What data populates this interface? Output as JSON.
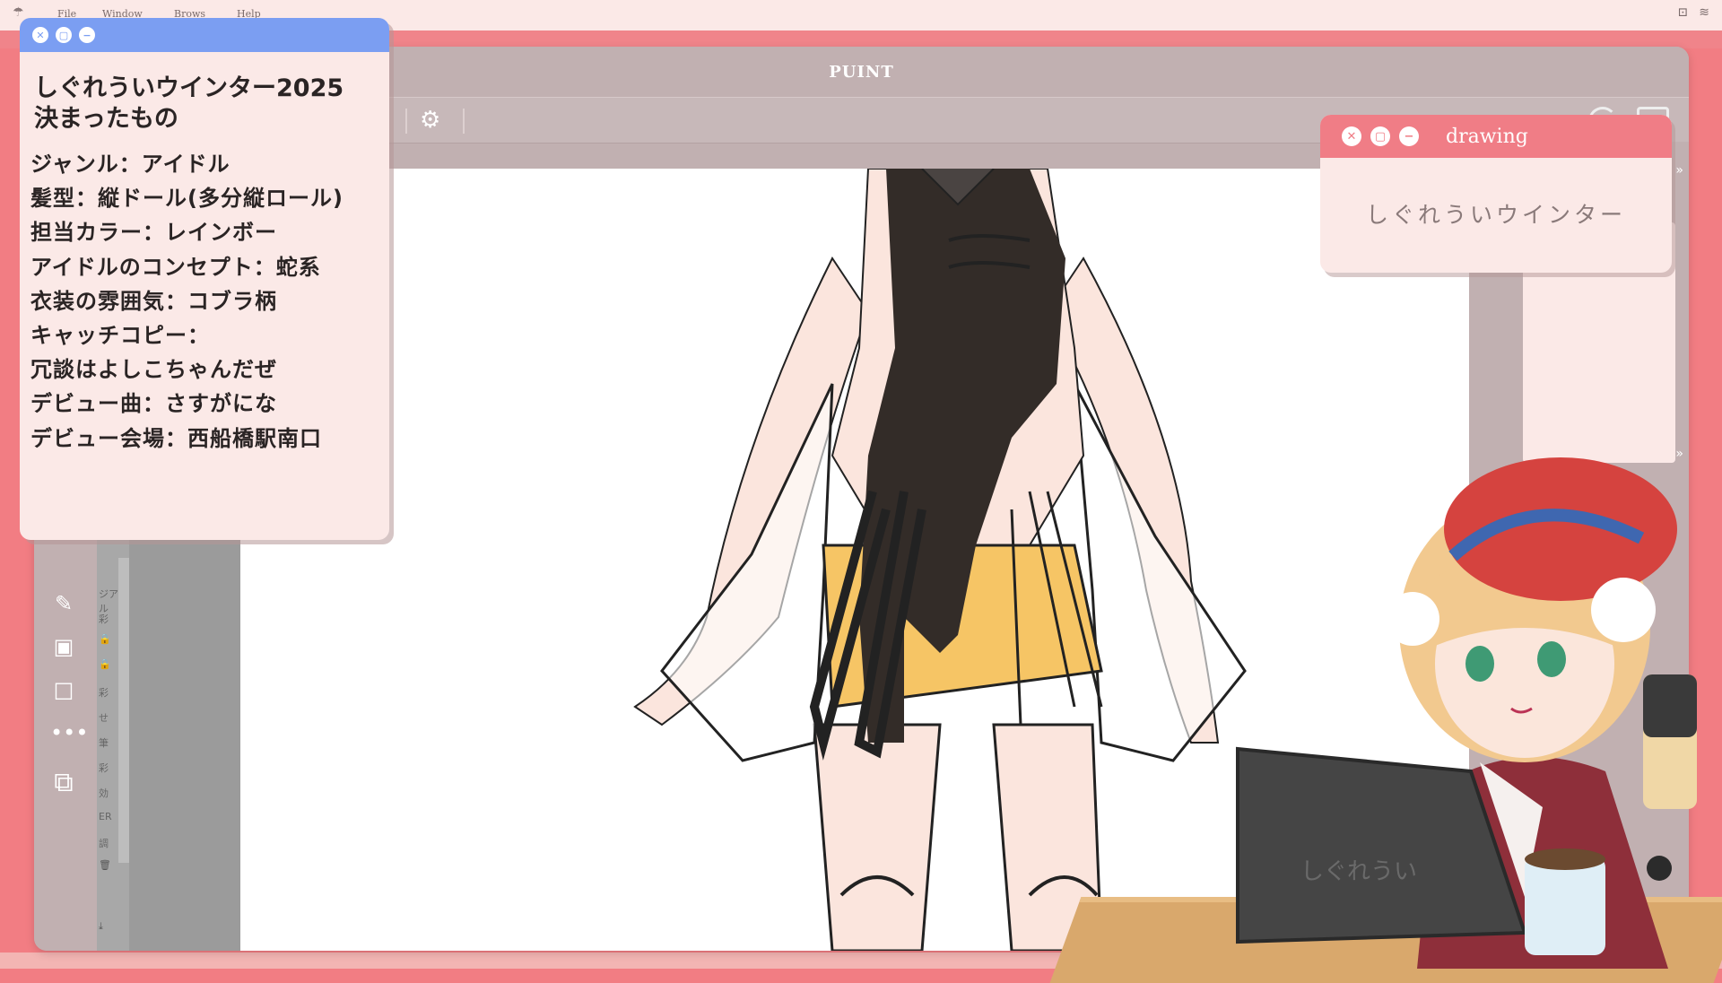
{
  "menubar": {
    "items": [
      "File",
      "Window",
      "Brows",
      "Help"
    ]
  },
  "app": {
    "title": "PUINT"
  },
  "info_window": {
    "title_line1": "しぐれういウインター2025",
    "title_line2": "決まったもの",
    "lines": [
      "ジャンル：アイドル",
      "髪型：縦ドール(多分縦ロール)",
      "担当カラー：レインボー",
      "アイドルのコンセプト：蛇系",
      "衣装の雰囲気：コブラ柄",
      "キャッチコピー：",
      "冗談はよしこちゃんだぜ",
      "デビュー曲：さすがにな",
      "デビュー会場：西船橋駅南口"
    ]
  },
  "drawing_window": {
    "title": "drawing",
    "text": "しぐれういウインター"
  },
  "layer_strip": {
    "labels": [
      "ジアル",
      "彩",
      "彩",
      "せ",
      "筆",
      "彩",
      "効",
      "ER",
      "調"
    ]
  },
  "tablet_label": "しぐれうい",
  "colors": {
    "background": "#f27d83",
    "info_titlebar": "#7b9ef2",
    "drawing_titlebar": "#f07d86",
    "window_body": "#fbe9e7",
    "app_chrome": "#c1b0b1"
  }
}
